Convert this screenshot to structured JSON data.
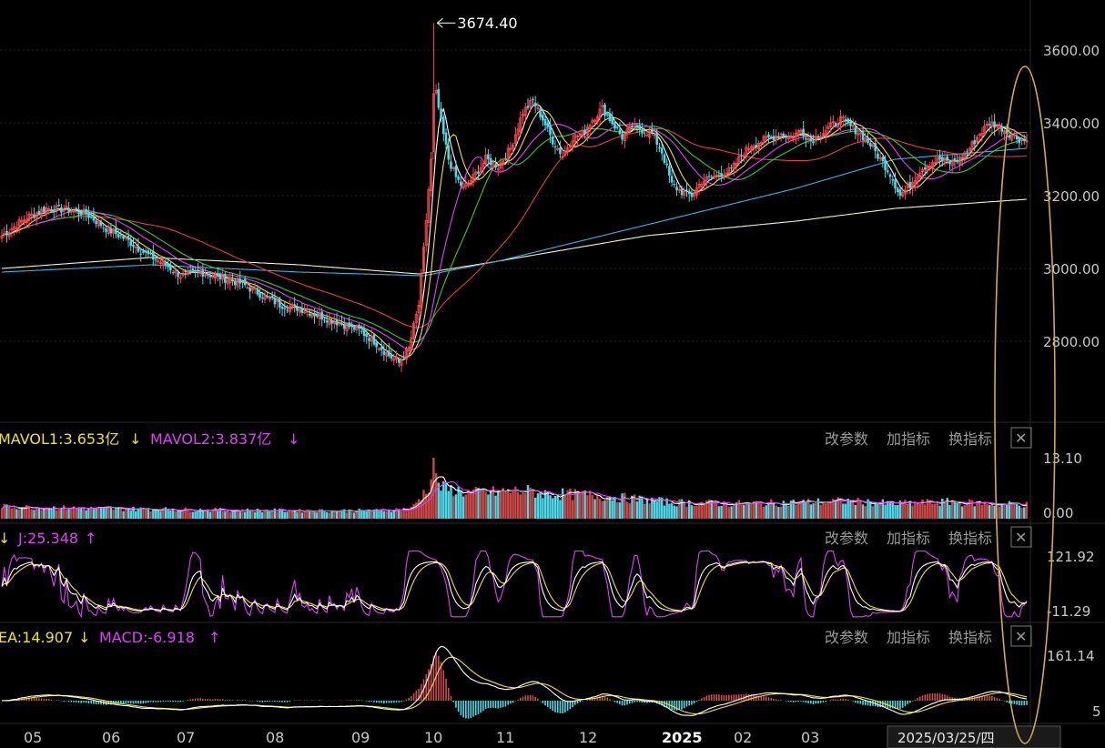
{
  "colors": {
    "up": "#ff4a4a",
    "down": "#4fd8e8",
    "ma5": "#ffffff",
    "ma10": "#f0e130",
    "ma20": "#e040fb",
    "ma30": "#35c935",
    "ma60": "#e04040",
    "ma120": "#3fb0e0",
    "ma250": "#f5f0c8",
    "grid": "#222222",
    "annotation": "#d8a94a"
  },
  "chart_data": [
    {
      "type": "candlestick",
      "panel": "price",
      "y_ticks": [
        "3600.00",
        "3400.00",
        "3200.00",
        "3000.00",
        "2800.00"
      ],
      "ylim": [
        2700,
        3700
      ],
      "peak_label": "3674.40",
      "x_months": [
        "05",
        "06",
        "07",
        "08",
        "09",
        "10",
        "11",
        "12",
        "2025",
        "02",
        "03"
      ],
      "anchors": [
        [
          0,
          3090
        ],
        [
          10,
          3140
        ],
        [
          18,
          3165
        ],
        [
          28,
          3160
        ],
        [
          34,
          3150
        ],
        [
          42,
          3110
        ],
        [
          50,
          3080
        ],
        [
          58,
          3040
        ],
        [
          66,
          3010
        ],
        [
          72,
          2980
        ],
        [
          80,
          2990
        ],
        [
          88,
          2975
        ],
        [
          96,
          2960
        ],
        [
          104,
          2930
        ],
        [
          112,
          2900
        ],
        [
          120,
          2890
        ],
        [
          128,
          2870
        ],
        [
          136,
          2850
        ],
        [
          144,
          2830
        ],
        [
          150,
          2800
        ],
        [
          156,
          2760
        ],
        [
          160,
          2740
        ],
        [
          164,
          2780
        ],
        [
          168,
          2900
        ],
        [
          170,
          3050
        ],
        [
          173,
          3300
        ],
        [
          175,
          3480
        ],
        [
          177,
          3400
        ],
        [
          180,
          3300
        ],
        [
          183,
          3250
        ],
        [
          186,
          3220
        ],
        [
          190,
          3250
        ],
        [
          195,
          3300
        ],
        [
          200,
          3280
        ],
        [
          205,
          3330
        ],
        [
          210,
          3430
        ],
        [
          214,
          3460
        ],
        [
          218,
          3410
        ],
        [
          222,
          3350
        ],
        [
          226,
          3310
        ],
        [
          230,
          3360
        ],
        [
          234,
          3370
        ],
        [
          238,
          3410
        ],
        [
          242,
          3440
        ],
        [
          246,
          3400
        ],
        [
          250,
          3360
        ],
        [
          254,
          3390
        ],
        [
          258,
          3380
        ],
        [
          262,
          3370
        ],
        [
          266,
          3320
        ],
        [
          270,
          3230
        ],
        [
          274,
          3210
        ],
        [
          278,
          3200
        ],
        [
          282,
          3240
        ],
        [
          286,
          3250
        ],
        [
          290,
          3260
        ],
        [
          294,
          3270
        ],
        [
          298,
          3310
        ],
        [
          302,
          3340
        ],
        [
          306,
          3350
        ],
        [
          310,
          3360
        ],
        [
          314,
          3370
        ],
        [
          318,
          3360
        ],
        [
          322,
          3380
        ],
        [
          326,
          3350
        ],
        [
          330,
          3370
        ],
        [
          334,
          3390
        ],
        [
          338,
          3410
        ],
        [
          342,
          3390
        ],
        [
          346,
          3370
        ],
        [
          350,
          3340
        ],
        [
          354,
          3300
        ],
        [
          358,
          3260
        ],
        [
          362,
          3200
        ],
        [
          366,
          3230
        ],
        [
          370,
          3270
        ],
        [
          374,
          3290
        ],
        [
          378,
          3300
        ],
        [
          382,
          3290
        ],
        [
          386,
          3300
        ],
        [
          390,
          3330
        ],
        [
          394,
          3370
        ],
        [
          398,
          3400
        ],
        [
          402,
          3390
        ],
        [
          406,
          3370
        ],
        [
          410,
          3355
        ],
        [
          413,
          3350
        ]
      ],
      "series": [
        {
          "name": "MA250",
          "anchors": [
            [
              0,
              3000
            ],
            [
              60,
              3030
            ],
            [
              120,
              3010
            ],
            [
              168,
              2985
            ],
            [
              200,
              3020
            ],
            [
              260,
              3090
            ],
            [
              320,
              3130
            ],
            [
              360,
              3165
            ],
            [
              413,
              3190
            ]
          ]
        },
        {
          "name": "MA120",
          "anchors": [
            [
              0,
              2990
            ],
            [
              60,
              3010
            ],
            [
              120,
              2990
            ],
            [
              170,
              2980
            ],
            [
              200,
              3020
            ],
            [
              260,
              3120
            ],
            [
              320,
              3220
            ],
            [
              360,
              3300
            ],
            [
              413,
              3330
            ]
          ]
        }
      ]
    },
    {
      "type": "bar",
      "panel": "volume",
      "indicators": [
        {
          "label": "MAVOL1:3.653亿",
          "arrow": "↓",
          "color": "#f0e130"
        },
        {
          "label": "MAVOL2:3.837亿",
          "arrow": "↓",
          "color": "#e040fb"
        }
      ],
      "y_ticks": [
        "13.10",
        "0.00"
      ],
      "ylim": [
        0,
        13.1
      ],
      "anchors": [
        [
          0,
          2.6
        ],
        [
          40,
          2.2
        ],
        [
          100,
          1.8
        ],
        [
          150,
          1.7
        ],
        [
          165,
          2.2
        ],
        [
          170,
          5.5
        ],
        [
          174,
          8.8
        ],
        [
          178,
          6.5
        ],
        [
          190,
          5.5
        ],
        [
          210,
          6.0
        ],
        [
          220,
          5.4
        ],
        [
          240,
          5.0
        ],
        [
          270,
          3.5
        ],
        [
          300,
          3.2
        ],
        [
          340,
          3.8
        ],
        [
          360,
          3.2
        ],
        [
          380,
          3.6
        ],
        [
          413,
          3.0
        ]
      ]
    },
    {
      "type": "line",
      "panel": "kdj",
      "indicators": [
        {
          "label": "J:25.348",
          "arrow": "↑",
          "color": "#e040fb"
        }
      ],
      "leading_arrow": "↓",
      "y_ticks": [
        "121.92",
        "-11.29"
      ],
      "ylim": [
        -11.29,
        121.92
      ]
    },
    {
      "type": "bar",
      "panel": "macd",
      "indicators": [
        {
          "label": "EA:14.907",
          "arrow": "↓",
          "color": "#f0e130"
        },
        {
          "label": "MACD:-6.918",
          "arrow": "↑",
          "color": "#e040fb"
        }
      ],
      "y_ticks": [
        "161.14",
        "5"
      ],
      "ylim": [
        0,
        161.14
      ]
    }
  ],
  "panel_buttons": [
    "改参数",
    "加指标",
    "换指标"
  ],
  "close_glyph": "✕",
  "date_tip": "2025/03/25/四"
}
